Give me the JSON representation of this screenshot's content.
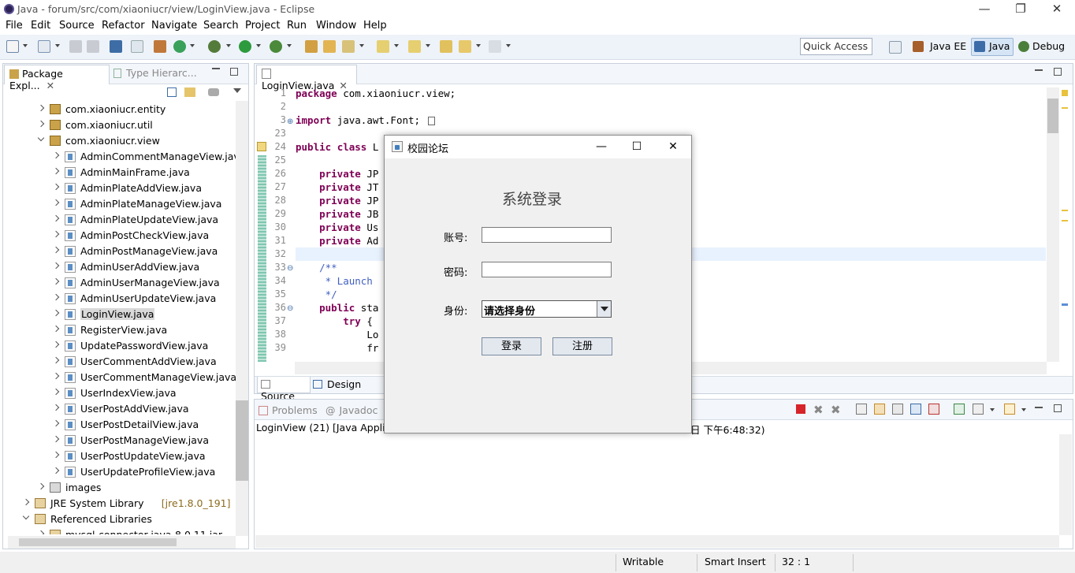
{
  "window": {
    "title": "Java - forum/src/com/xiaoniucr/view/LoginView.java - Eclipse",
    "minimize": "—",
    "maximize": "❐",
    "close": "✕"
  },
  "menu": [
    "File",
    "Edit",
    "Source",
    "Refactor",
    "Navigate",
    "Search",
    "Project",
    "Run",
    "Window",
    "Help"
  ],
  "toolbar": {
    "quick_access": "Quick Access",
    "perspectives": [
      "Java EE",
      "Java",
      "Debug"
    ]
  },
  "package_explorer": {
    "tabs": [
      "Package Expl...",
      "Type Hierarc..."
    ],
    "items": [
      {
        "label": "com.xiaoniucr.entity",
        "kind": "package",
        "level": 2,
        "state": "collapsed"
      },
      {
        "label": "com.xiaoniucr.util",
        "kind": "package",
        "level": 2,
        "state": "collapsed"
      },
      {
        "label": "com.xiaoniucr.view",
        "kind": "package",
        "level": 2,
        "state": "expanded"
      },
      {
        "label": "AdminCommentManageView.java",
        "kind": "java",
        "level": 3
      },
      {
        "label": "AdminMainFrame.java",
        "kind": "java",
        "level": 3
      },
      {
        "label": "AdminPlateAddView.java",
        "kind": "java",
        "level": 3
      },
      {
        "label": "AdminPlateManageView.java",
        "kind": "java",
        "level": 3
      },
      {
        "label": "AdminPlateUpdateView.java",
        "kind": "java",
        "level": 3
      },
      {
        "label": "AdminPostCheckView.java",
        "kind": "java",
        "level": 3
      },
      {
        "label": "AdminPostManageView.java",
        "kind": "java",
        "level": 3
      },
      {
        "label": "AdminUserAddView.java",
        "kind": "java",
        "level": 3
      },
      {
        "label": "AdminUserManageView.java",
        "kind": "java",
        "level": 3
      },
      {
        "label": "AdminUserUpdateView.java",
        "kind": "java",
        "level": 3
      },
      {
        "label": "LoginView.java",
        "kind": "java",
        "level": 3,
        "selected": true
      },
      {
        "label": "RegisterView.java",
        "kind": "java",
        "level": 3
      },
      {
        "label": "UpdatePasswordView.java",
        "kind": "java",
        "level": 3
      },
      {
        "label": "UserCommentAddView.java",
        "kind": "java",
        "level": 3
      },
      {
        "label": "UserCommentManageView.java",
        "kind": "java",
        "level": 3
      },
      {
        "label": "UserIndexView.java",
        "kind": "java",
        "level": 3
      },
      {
        "label": "UserPostAddView.java",
        "kind": "java",
        "level": 3
      },
      {
        "label": "UserPostDetailView.java",
        "kind": "java",
        "level": 3
      },
      {
        "label": "UserPostManageView.java",
        "kind": "java",
        "level": 3
      },
      {
        "label": "UserPostUpdateView.java",
        "kind": "java",
        "level": 3
      },
      {
        "label": "UserUpdateProfileView.java",
        "kind": "java",
        "level": 3
      },
      {
        "label": "images",
        "kind": "folder",
        "level": 2,
        "state": "collapsed"
      },
      {
        "label": "JRE System Library",
        "suffix": "[jre1.8.0_191]",
        "kind": "library",
        "level": 1,
        "state": "collapsed"
      },
      {
        "label": "Referenced Libraries",
        "kind": "library",
        "level": 1,
        "state": "expanded"
      },
      {
        "label": "mysql-connector-java-8.0.11.jar",
        "kind": "jar",
        "level": 2,
        "state": "collapsed"
      }
    ]
  },
  "editor": {
    "tab": "LoginView.java",
    "lines": [
      {
        "n": "1",
        "text": "package com.xiaoniucr.view;"
      },
      {
        "n": "2",
        "text": ""
      },
      {
        "n": "3",
        "text": "import java.awt.Font;"
      },
      {
        "n": "23",
        "text": ""
      },
      {
        "n": "24",
        "text": "public class L"
      },
      {
        "n": "25",
        "text": ""
      },
      {
        "n": "26",
        "text": "    private JP"
      },
      {
        "n": "27",
        "text": "    private JT"
      },
      {
        "n": "28",
        "text": "    private JP"
      },
      {
        "n": "29",
        "text": "    private JB"
      },
      {
        "n": "30",
        "text": "    private Us"
      },
      {
        "n": "31",
        "text": "    private Ad"
      },
      {
        "n": "32",
        "text": ""
      },
      {
        "n": "33",
        "text": "    /**"
      },
      {
        "n": "34",
        "text": "     * Launch"
      },
      {
        "n": "35",
        "text": "     */"
      },
      {
        "n": "36",
        "text": "    public sta"
      },
      {
        "n": "37",
        "text": "        try {"
      },
      {
        "n": "38",
        "text": "            Lo"
      },
      {
        "n": "39",
        "text": "            fr"
      }
    ],
    "bottom_tabs": [
      "Source",
      "Design"
    ]
  },
  "console": {
    "tabs": [
      "Problems",
      "Javadoc"
    ],
    "line_left": "LoginView (21) [Java Applica",
    "line_right": "日 下午6:48:32)"
  },
  "dialog": {
    "title": "校园论坛",
    "heading": "系统登录",
    "account_label": "账号:",
    "password_label": "密码:",
    "role_label": "身份:",
    "role_selected": "请选择身份",
    "login_button": "登录",
    "register_button": "注册",
    "minimize": "—",
    "maximize": "☐",
    "close": "✕"
  },
  "statusbar": {
    "mode": "Writable",
    "insert": "Smart Insert",
    "position": "32 : 1"
  }
}
